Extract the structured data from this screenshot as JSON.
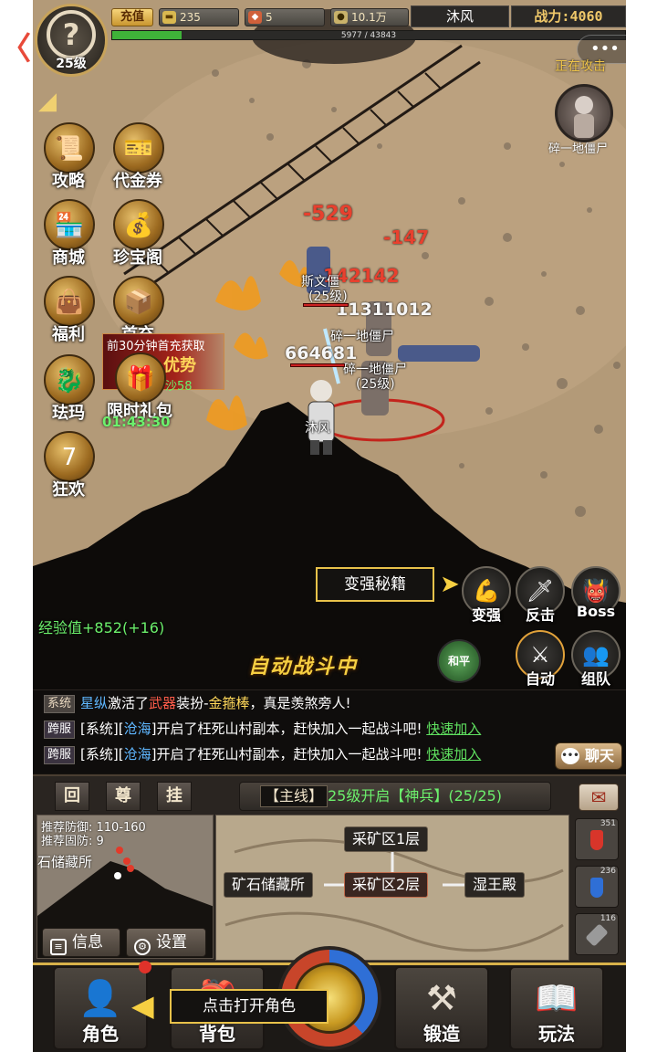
{
  "top": {
    "recharge_label": "充值",
    "gold": "235",
    "gems": "5",
    "coins": "10.1万",
    "player_name": "沐风",
    "power_label": "战力:4060",
    "exp_text": "5977 / 43843",
    "exp_fraction": 0.136
  },
  "avatar": {
    "level": "25级",
    "glyph": "?"
  },
  "target": {
    "status": "正在攻击",
    "name": "碎一地僵尸"
  },
  "left_menu": [
    {
      "label": "攻略",
      "glyph": "📜"
    },
    {
      "label": "代金券",
      "glyph": "🎫"
    },
    {
      "label": "商城",
      "glyph": "🏪"
    },
    {
      "label": "珍宝阁",
      "glyph": "💰"
    },
    {
      "label": "福利",
      "glyph": "👜"
    },
    {
      "label": "首充",
      "glyph": "📦"
    },
    {
      "label": "珐玛",
      "glyph": "🐉"
    },
    {
      "label": "限时礼包",
      "glyph": "🎁"
    },
    {
      "label": "狂欢",
      "glyph": "7"
    }
  ],
  "promo": {
    "line1": "前30分钟首充获取",
    "line2": "优势",
    "line3": "沙58"
  },
  "timer": "01:43:30",
  "battle": {
    "damage_numbers": [
      "-529",
      "-147",
      "142142",
      "11311012",
      "664681"
    ],
    "labels": [
      "斯文僵",
      "(25级)",
      "碎一地僵尸",
      "(25级)",
      "碎一地僵尸",
      "沐风"
    ]
  },
  "secret_label": "变强秘籍",
  "right_buttons": [
    {
      "label": "变强",
      "glyph": "💪"
    },
    {
      "label": "反击",
      "glyph": "🗡"
    },
    {
      "label": "Boss",
      "glyph": "👹"
    },
    {
      "label": "自动",
      "glyph": "⚔"
    },
    {
      "label": "组队",
      "glyph": "👥"
    }
  ],
  "peace_label": "和平",
  "exp_gain": "经验值+852(+16)",
  "auto_battle": "自动战斗中",
  "chat": [
    {
      "tag": "系统",
      "pre": "",
      "name": "星纵",
      "mid": "激活了",
      "item": "武器",
      "post": "装扮-",
      "item2": "金箍棒",
      "end": "，真是羡煞旁人!",
      "link": ""
    },
    {
      "tag": "跨服",
      "pre": "[系统][",
      "name": "沧海",
      "mid": "]开启了枉死山村副本，赶快加入一起战斗吧!",
      "item": "",
      "post": "",
      "item2": "",
      "end": "",
      "link": "快速加入"
    },
    {
      "tag": "跨服",
      "pre": "[系统][",
      "name": "沧海",
      "mid": "]开启了枉死山村副本，赶快加入一起战斗吧!",
      "item": "",
      "post": "",
      "item2": "",
      "end": "",
      "link": "快速加入"
    }
  ],
  "chat_button": "聊天",
  "panel": {
    "buttons": [
      "回",
      "尊",
      "挂"
    ],
    "quest_tag": "【主线】",
    "quest_text": "25级开启【神兵】(25/25)",
    "mail_icon": "✉"
  },
  "minimap": {
    "defense": "推荐防御: 110-160",
    "solid_defense": "推荐固防: 9",
    "area": "石储藏所",
    "info_button": "信息",
    "settings_button": "设置"
  },
  "world_nodes": {
    "n1": "采矿区1层",
    "n2": "矿石储藏所",
    "n3": "采矿区2层",
    "n4": "湿王殿"
  },
  "potions": [
    {
      "count": "351",
      "color": "#d8352a"
    },
    {
      "count": "236",
      "color": "#2f6fd6"
    },
    {
      "count": "116",
      "color": "#9a9a9a"
    }
  ],
  "bottom_nav": [
    {
      "label": "角色",
      "glyph": "👤"
    },
    {
      "label": "背包",
      "glyph": "🎒"
    },
    {
      "label": "锻造",
      "glyph": "⚒"
    },
    {
      "label": "玩法",
      "glyph": "📖"
    }
  ],
  "tooltip": "点击打开角色"
}
